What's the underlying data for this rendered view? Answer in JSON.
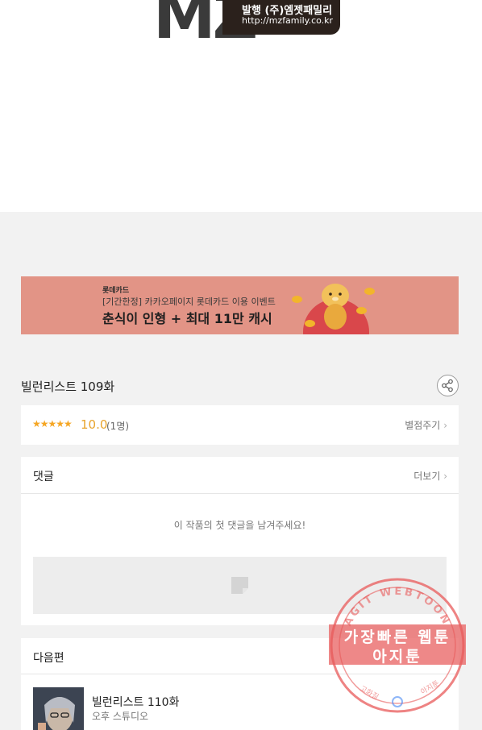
{
  "publisher": {
    "logo": "MZ",
    "label": "발행 (주)엠젯패밀리",
    "url": "http://mzfamily.co.kr"
  },
  "banner": {
    "brand": "롯데카드",
    "subtitle": "[기간한정] 카카오페이지 롯데카드 이용 이벤트",
    "title": "춘식이 인형 + 최대 11만 캐시"
  },
  "episode": {
    "title": "빌런리스트 109화",
    "share_icon": "share-icon"
  },
  "rating": {
    "stars": "★★★★★",
    "star_value": 5,
    "score": "10.0",
    "count": "(1명)",
    "rate_label": "별점주기"
  },
  "comments": {
    "title": "댓글",
    "more_label": "더보기",
    "empty_text": "이 작품의 첫 댓글을 남겨주세요!"
  },
  "next": {
    "header": "다음편",
    "title": "빌런리스트 110화",
    "studio": "오후 스튜디오"
  },
  "watermark": {
    "ring_text": "AGIT WEBTOON",
    "line1": "가장빠른 웹툰",
    "line2": "아지툰",
    "bottom_left": "고화질",
    "bottom_right": "아지툰"
  },
  "colors": {
    "banner_bg": "#e29486",
    "star": "#f5a623",
    "watermark": "#e85a5a"
  }
}
